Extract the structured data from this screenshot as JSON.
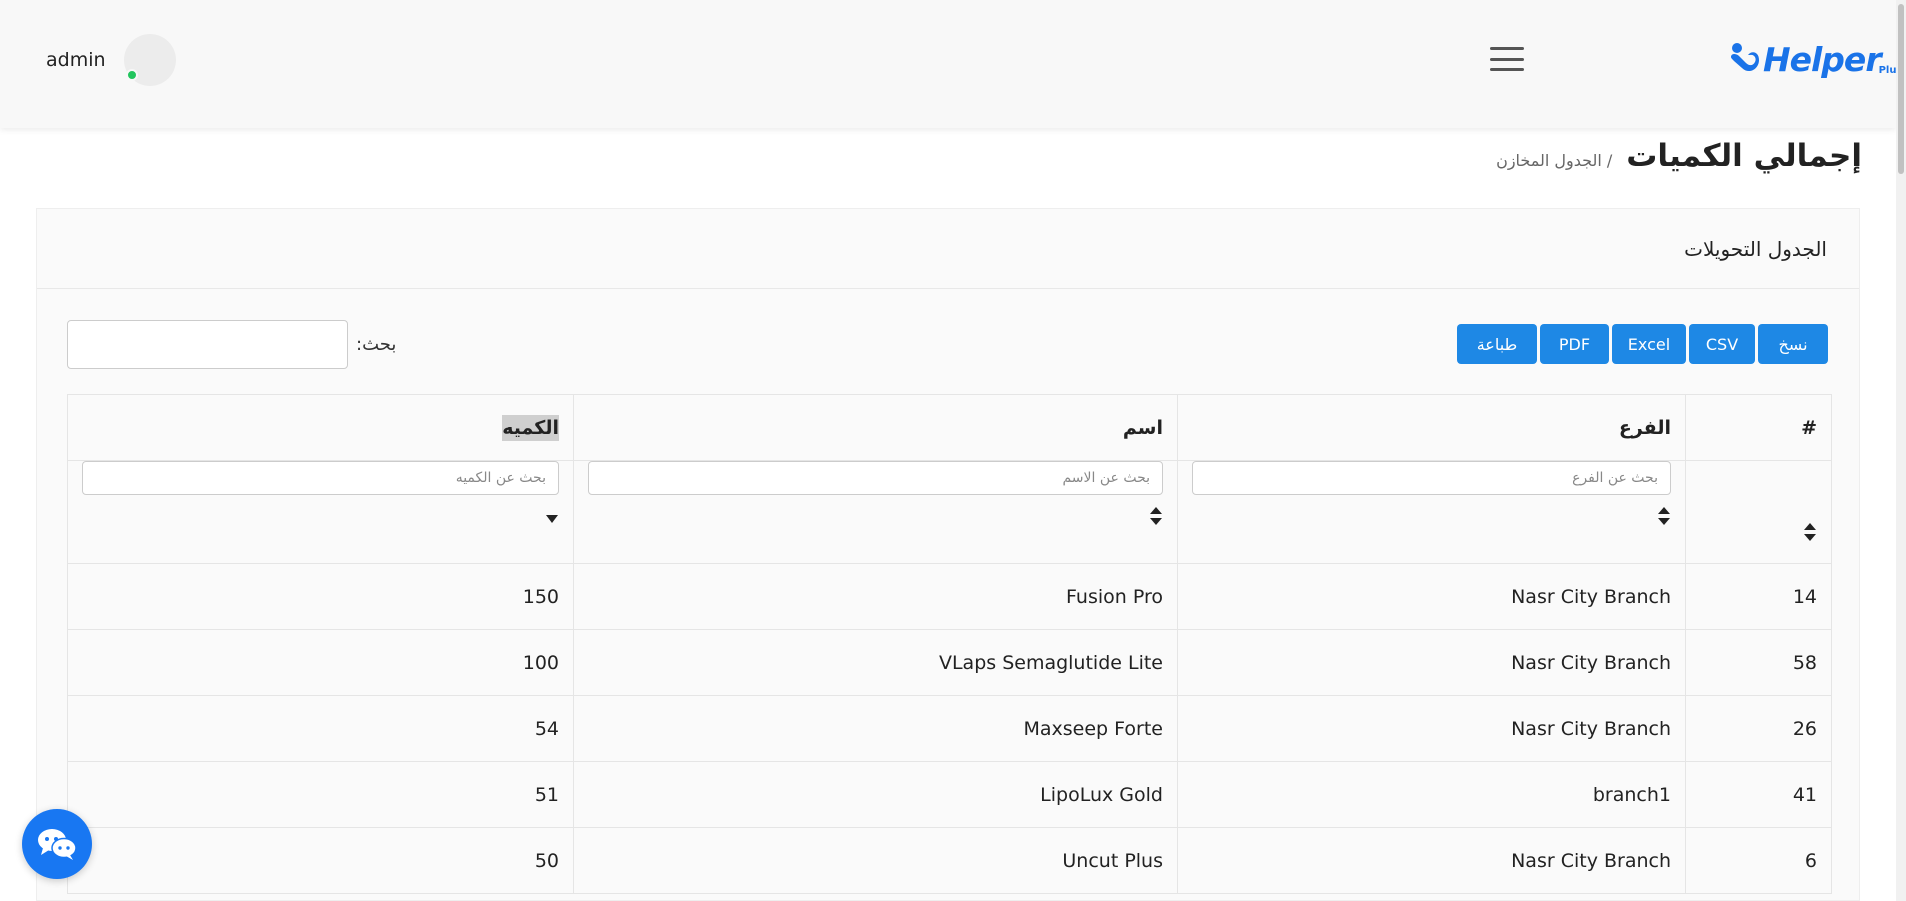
{
  "header": {
    "user_name": "admin",
    "logo_text": "Helper",
    "logo_suffix": "Plus"
  },
  "page": {
    "title": "إجمالي الكميات",
    "breadcrumb": "/ الجدول المخازن"
  },
  "card": {
    "title": "الجدول التحويلات"
  },
  "toolbar": {
    "buttons": [
      {
        "label": "نسخ"
      },
      {
        "label": "CSV"
      },
      {
        "label": "Excel"
      },
      {
        "label": "PDF"
      },
      {
        "label": "طباعة"
      }
    ],
    "search_label": "بحث:"
  },
  "table": {
    "columns": [
      "#",
      "الفرع",
      "اسم",
      "الكميه"
    ],
    "filters": {
      "branch_placeholder": "بحث عن الفرع",
      "name_placeholder": "بحث عن الاسم",
      "quantity_placeholder": "بحث عن الكميه"
    },
    "rows": [
      {
        "id": "14",
        "branch": "Nasr City Branch",
        "name": "Fusion Pro",
        "quantity": "150"
      },
      {
        "id": "58",
        "branch": "Nasr City Branch",
        "name": "VLaps Semaglutide Lite",
        "quantity": "100"
      },
      {
        "id": "26",
        "branch": "Nasr City Branch",
        "name": "Maxseep Forte",
        "quantity": "54"
      },
      {
        "id": "41",
        "branch": "branch1",
        "name": "LipoLux Gold",
        "quantity": "51"
      },
      {
        "id": "6",
        "branch": "Nasr City Branch",
        "name": "Uncut Plus",
        "quantity": "50"
      }
    ]
  },
  "colors": {
    "accent": "#1e88e5",
    "status_online": "#22c55e",
    "chat_button": "#1877f2"
  }
}
